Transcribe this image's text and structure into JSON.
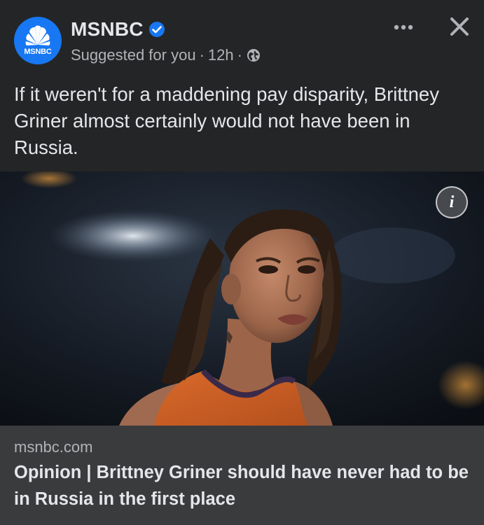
{
  "post": {
    "page_name": "MSNBC",
    "avatar_label": "MSNBC",
    "suggested": "Suggested for you",
    "separator": "·",
    "time": "12h",
    "caption": "If it weren't for a maddening pay disparity, Brittney Griner almost certainly would not have been in Russia.",
    "info_glyph": "i",
    "link": {
      "domain": "msnbc.com",
      "title": "Opinion | Brittney Griner should have never had to be in Russia in the first place"
    }
  },
  "icons": {
    "avatar": "peacock-logo-icon",
    "verified": "verified-badge-icon",
    "audience": "globe-icon",
    "more": "more-options-icon",
    "close": "close-icon",
    "info": "info-icon"
  },
  "colors": {
    "background": "#242526",
    "link_footer": "#3a3b3c",
    "primary_text": "#e4e6eb",
    "secondary_text": "#b0b3b8",
    "brand_blue": "#1877f2"
  }
}
